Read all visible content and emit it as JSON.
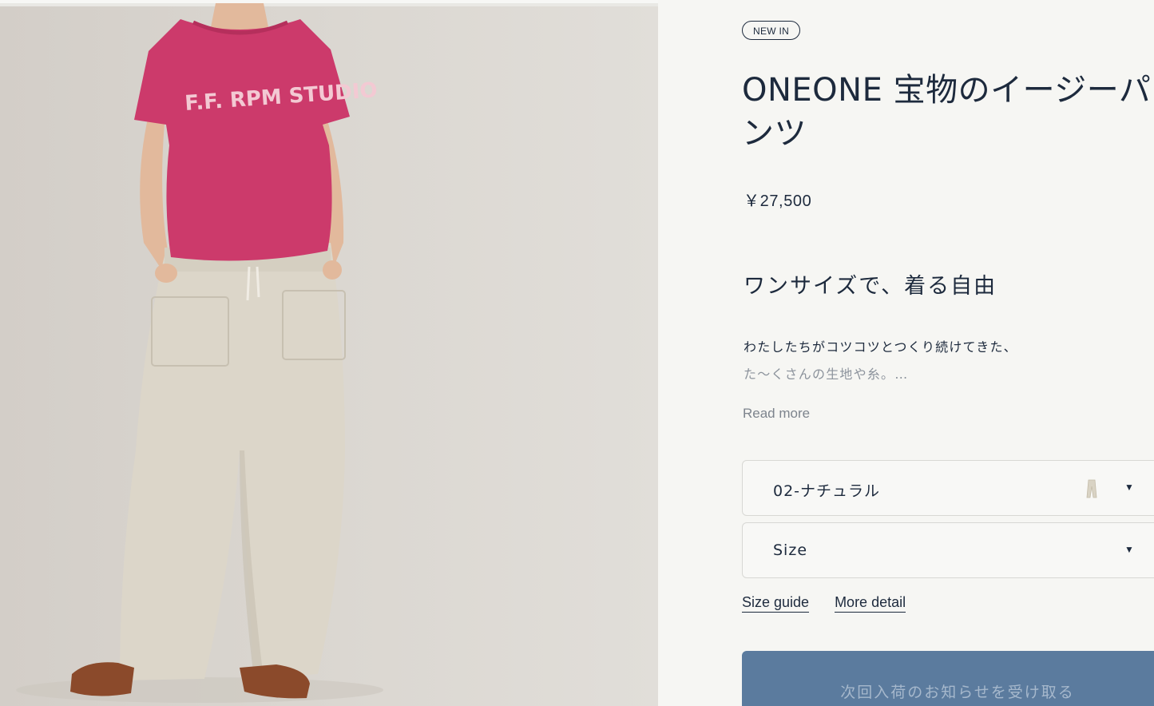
{
  "badge": "NEW IN",
  "product": {
    "title": "ONEONE 宝物のイージーパンツ",
    "price": "￥27,500",
    "tagline": "ワンサイズで、着る自由",
    "description_line1": "わたしたちがコツコツとつくり続けてきた、",
    "description_line2": "た～くさんの生地や糸。…",
    "read_more": "Read more",
    "tshirt_print": "F.F. RPM STUDIO"
  },
  "options": {
    "color": {
      "selected": "02-ナチュラル",
      "swatch_color": "#d9d3c4"
    },
    "size": {
      "selected": "Size"
    }
  },
  "links": {
    "size_guide": "Size guide",
    "more_detail": "More detail"
  },
  "cta": {
    "notify_label": "次回入荷のお知らせを受け取る",
    "button_color": "#5b7b9e"
  },
  "colors": {
    "text_primary": "#1d2a3d",
    "tshirt": "#cc3a6b",
    "pants": "#dcd6c9",
    "shoes": "#8b4a2b"
  }
}
